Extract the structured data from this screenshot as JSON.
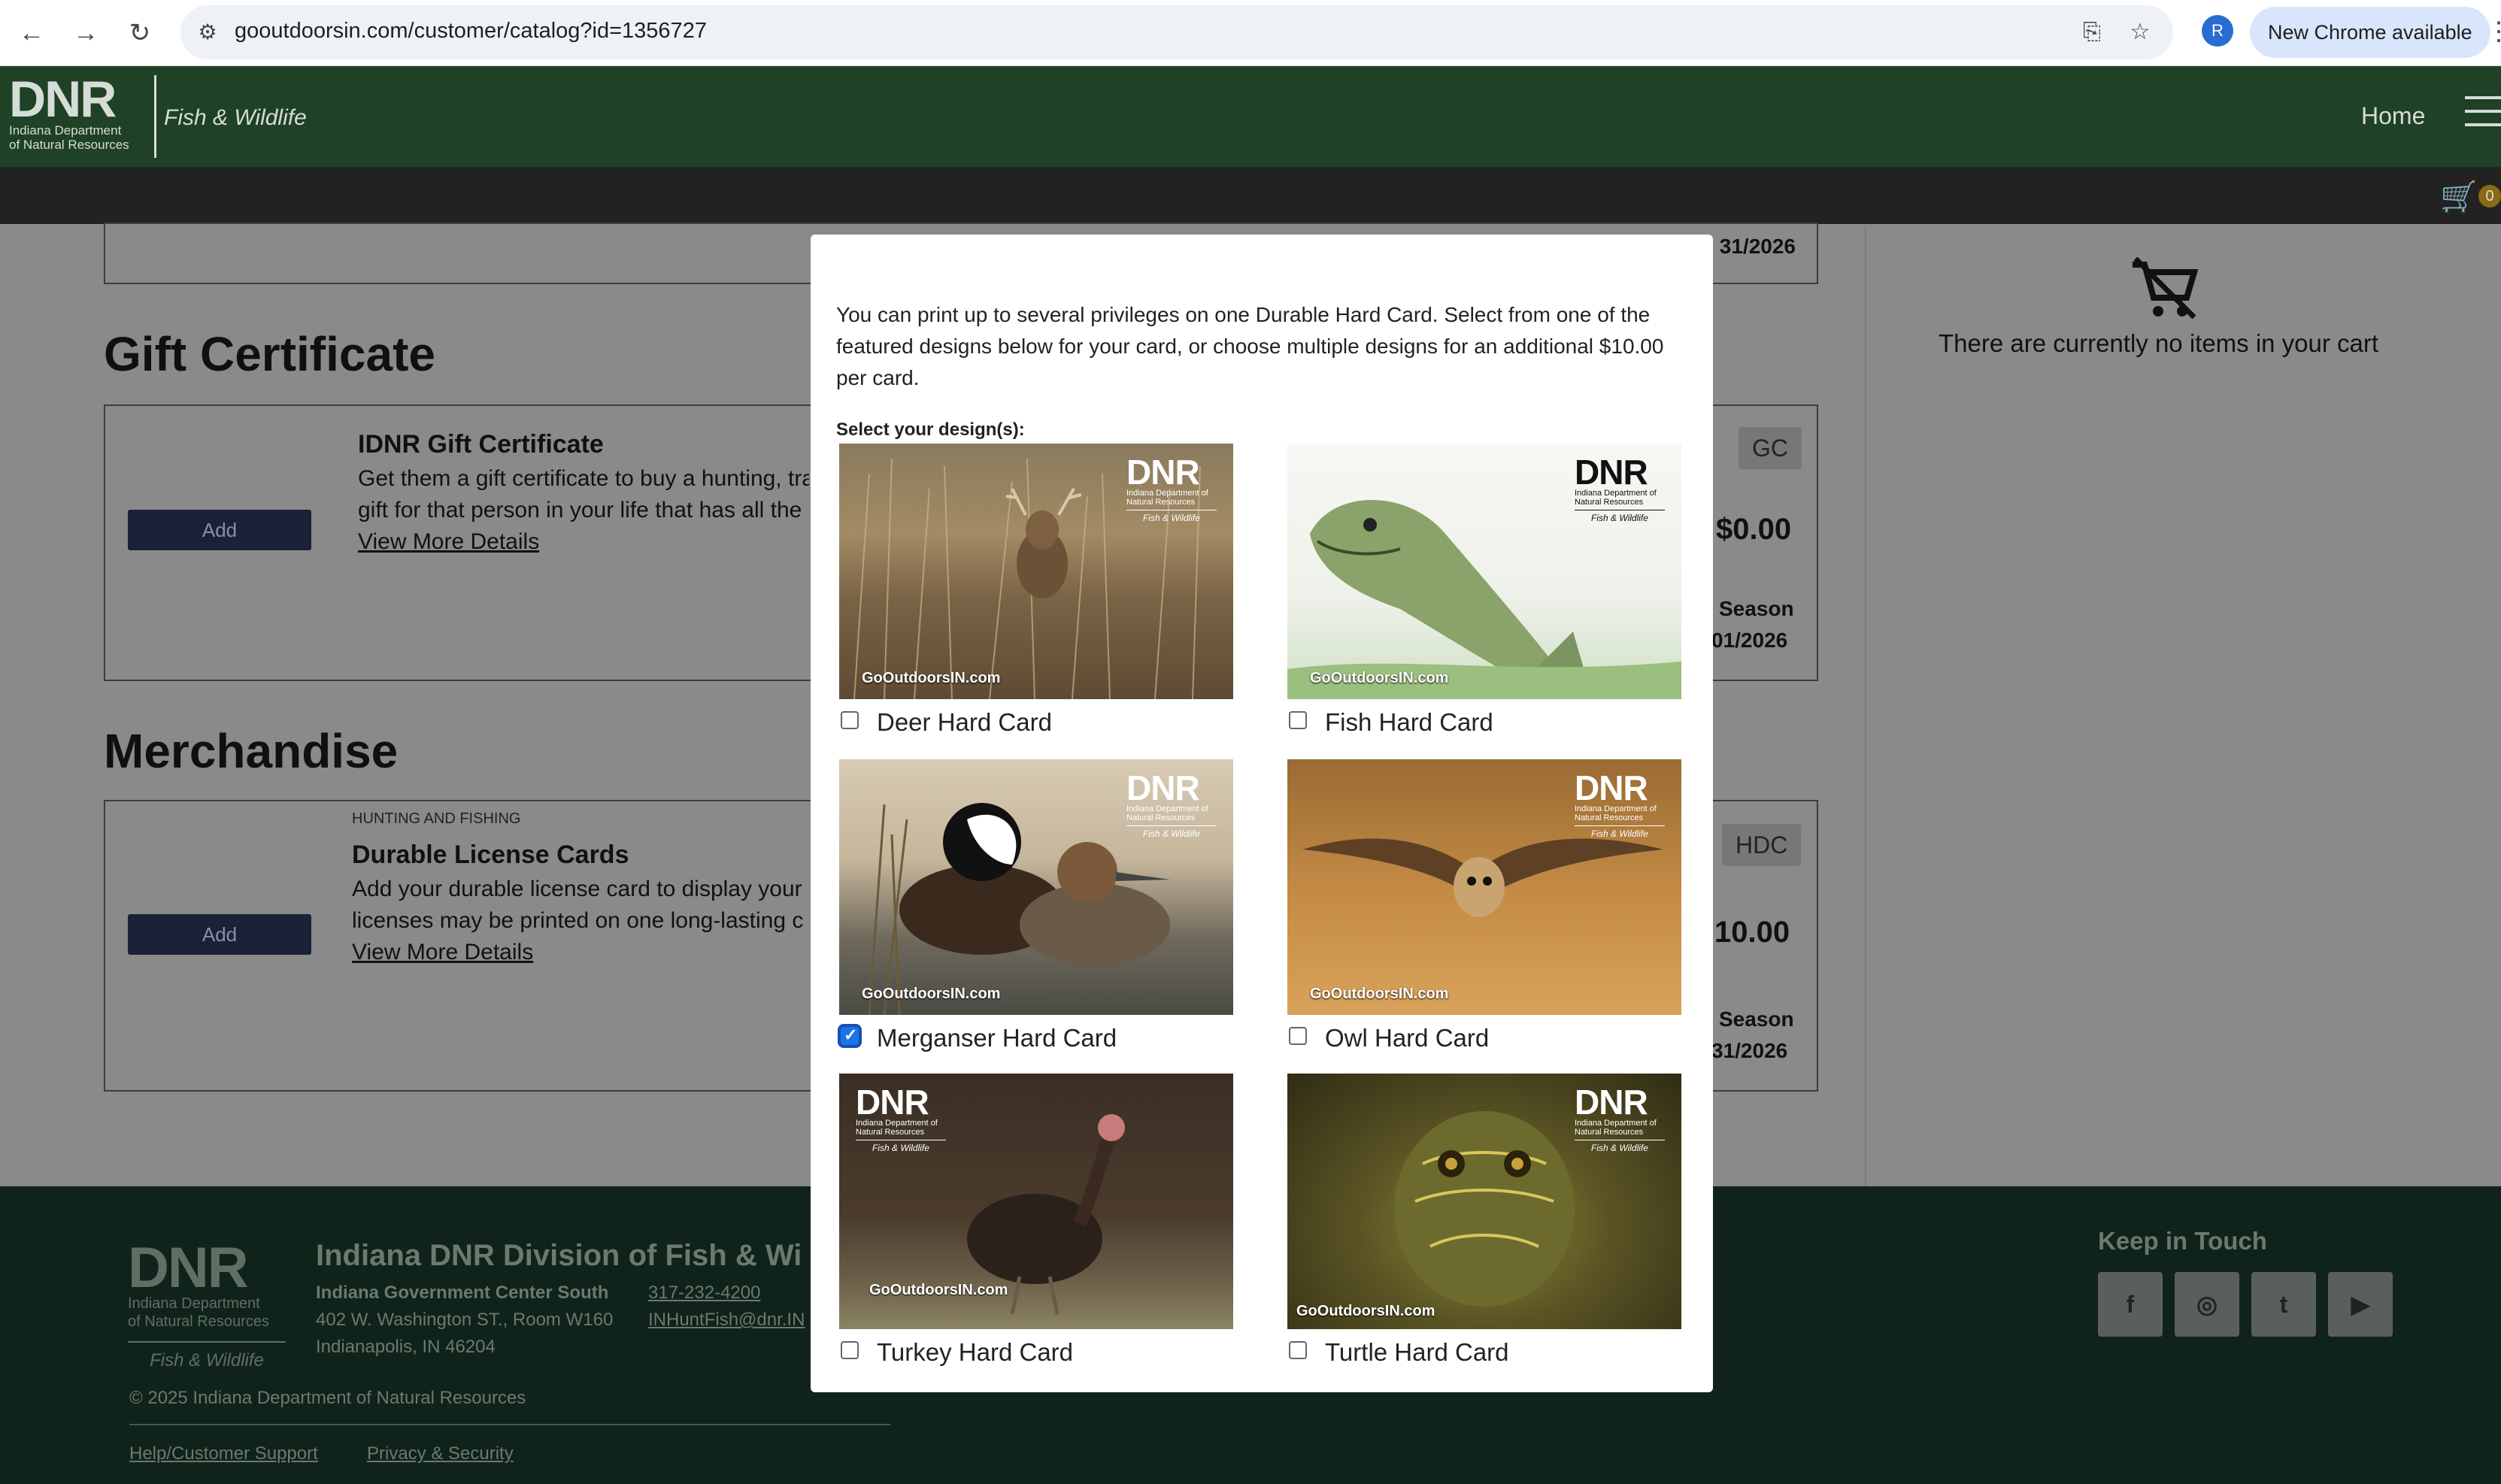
{
  "browser": {
    "url": "gooutdoorsin.com/customer/catalog?id=1356727",
    "profile_initial": "R",
    "update_label": "New Chrome available"
  },
  "header": {
    "logo_text": "DNR",
    "logo_sub1": "Indiana Department",
    "logo_sub2": "of Natural Resources",
    "division": "Fish & Wildlife",
    "home": "Home",
    "cart_count": "0"
  },
  "catalog": {
    "top_card_date": "31/2026",
    "gift": {
      "section_title": "Gift Certificate",
      "add_label": "Add",
      "title": "IDNR Gift Certificate",
      "desc1": "Get them a gift certificate to buy a hunting, tra",
      "desc2": "gift for that person in your life that has all the l",
      "link": "View More Details",
      "code": "GC",
      "price": "$0.00",
      "season": "Season",
      "date": "01/2026"
    },
    "merch": {
      "section_title": "Merchandise",
      "add_label": "Add",
      "category": "HUNTING AND FISHING",
      "title": "Durable License Cards",
      "desc1": "Add your durable license card to display your li",
      "desc2": "licenses may be printed on one long-lasting car",
      "link": "View More Details",
      "code": "HDC",
      "price": "10.00",
      "season": "Season",
      "date": "31/2026"
    }
  },
  "cart": {
    "empty_text": "There are currently no items in your cart"
  },
  "modal": {
    "intro": "You can print up to several privileges on one Durable Hard Card. Select from one of the featured designs below for your card, or choose multiple designs for an additional $10.00 per card.",
    "select_label": "Select your design(s):",
    "card_logo": "DNR",
    "card_logo_sub": "Indiana Department of Natural Resources",
    "card_logo_fw": "Fish & Wildlife",
    "card_site": "GoOutdoorsIN.com",
    "designs": [
      {
        "label": "Deer Hard Card",
        "checked": false
      },
      {
        "label": "Fish Hard Card",
        "checked": false
      },
      {
        "label": "Merganser Hard Card",
        "checked": true
      },
      {
        "label": "Owl Hard Card",
        "checked": false
      },
      {
        "label": "Turkey Hard Card",
        "checked": false
      },
      {
        "label": "Turtle Hard Card",
        "checked": false
      }
    ]
  },
  "footer": {
    "logo_text": "DNR",
    "logo_sub1": "Indiana Department",
    "logo_sub2": "of Natural Resources",
    "logo_fw": "Fish & Wildlife",
    "title": "Indiana DNR Division of Fish & Wi",
    "addr_bold": "Indiana Government Center South",
    "addr2": "402 W. Washington ST., Room W160",
    "addr3": "Indianapolis, IN 46204",
    "phone": "317-232-4200",
    "email": "INHuntFish@dnr.IN",
    "copyright": "© 2025 Indiana Department of Natural Resources",
    "help": "Help/Customer Support",
    "privacy": "Privacy & Security",
    "keep_in_touch": "Keep in Touch",
    "social": [
      "f",
      "◎",
      "t",
      "▶"
    ]
  }
}
